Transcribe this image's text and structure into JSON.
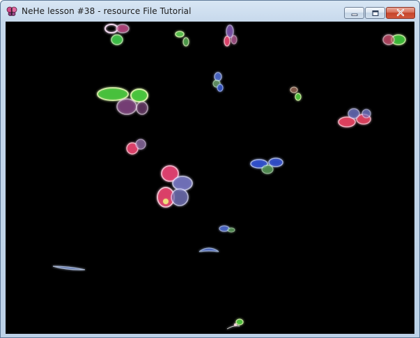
{
  "window": {
    "title": "NeHe lesson #38 - resource File Tutorial",
    "icon": "butterfly-app-icon",
    "caption_buttons": {
      "minimize_icon": "minimize-icon",
      "maximize_icon": "maximize-icon",
      "close_icon": "close-icon"
    },
    "client_background": "#000000",
    "frame_color": "#c7d9ec",
    "close_button_color": "#c4442a"
  },
  "scene": {
    "description_colors": {
      "green": "#6dff6a",
      "red": "#ff5a7e",
      "blue": "#5a7dff",
      "pale": "#e9d4e6"
    }
  }
}
